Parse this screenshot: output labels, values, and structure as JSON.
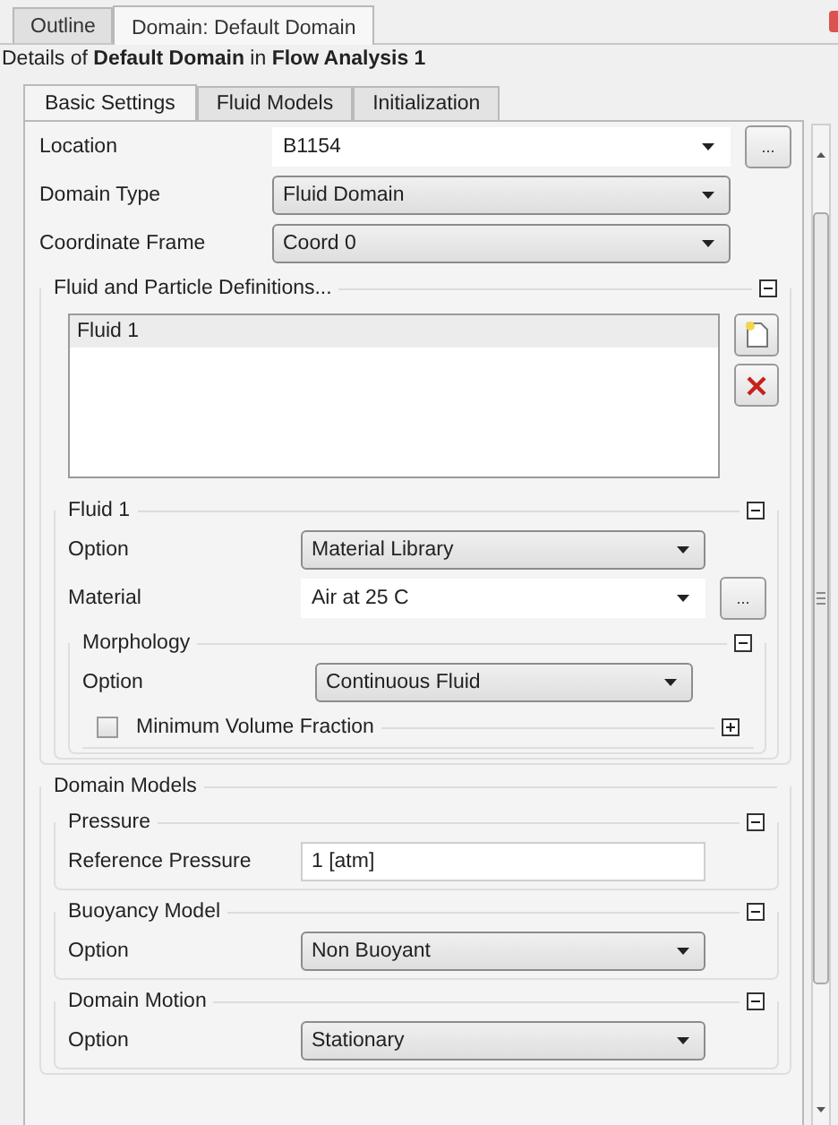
{
  "outer_tabs": [
    {
      "label": "Outline",
      "selected": false
    },
    {
      "label": "Domain: Default Domain",
      "selected": true
    }
  ],
  "details": "Details of **Default Domain** in **Flow Analysis 1**",
  "inner_tabs": [
    {
      "label": "Basic Settings",
      "selected": true
    },
    {
      "label": "Fluid Models",
      "selected": false
    },
    {
      "label": "Initialization",
      "selected": false
    }
  ],
  "items": [
    {
      "kind": "combo",
      "label": "Location",
      "value": "B1154",
      "browse": "..."
    },
    {
      "kind": "dropdown",
      "label": "Domain Type",
      "value": "Fluid Domain"
    },
    {
      "kind": "dropdown",
      "label": "Coordinate Frame",
      "value": "Coord 0"
    },
    {
      "kind": "group",
      "title": "Fluid and Particle Definitions...",
      "expanded": true,
      "children": [
        {
          "kind": "list",
          "items": [
            {
              "label": "Fluid 1",
              "selected": true
            }
          ]
        },
        {
          "kind": "group",
          "title": "Fluid 1",
          "expanded": true,
          "children": [
            {
              "kind": "dropdown",
              "label": "Option",
              "value": "Material Library"
            },
            {
              "kind": "combo",
              "label": "Material",
              "value": "Air at 25 C",
              "browse": "..."
            },
            {
              "kind": "group",
              "title": "Morphology",
              "expanded": true,
              "children": [
                {
                  "kind": "dropdown",
                  "label": "Option",
                  "value": "Continuous Fluid"
                },
                {
                  "kind": "group",
                  "title": "Minimum Volume Fraction",
                  "checked": false,
                  "expanded": false
                }
              ]
            }
          ]
        }
      ]
    },
    {
      "kind": "group",
      "title": "Domain Models",
      "children": [
        {
          "kind": "group",
          "title": "Pressure",
          "expanded": true,
          "children": [
            {
              "kind": "text",
              "label": "Reference Pressure",
              "value": "1 [atm]"
            }
          ]
        },
        {
          "kind": "group",
          "title": "Buoyancy Model",
          "expanded": true,
          "children": [
            {
              "kind": "dropdown",
              "label": "Option",
              "value": "Non Buoyant"
            }
          ]
        },
        {
          "kind": "group",
          "title": "Domain Motion",
          "expanded": true,
          "children": [
            {
              "kind": "dropdown",
              "label": "Option",
              "value": "Stationary"
            }
          ]
        }
      ]
    }
  ]
}
